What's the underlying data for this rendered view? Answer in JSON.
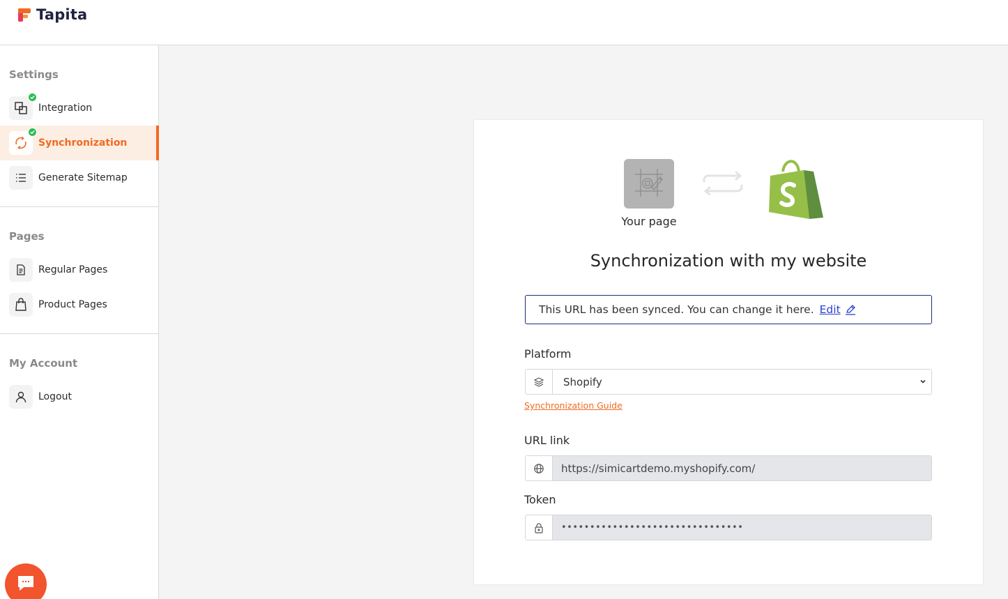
{
  "brand": {
    "name": "Tapita"
  },
  "sidebar": {
    "sections": [
      {
        "title": "Settings"
      },
      {
        "title": "Pages"
      },
      {
        "title": "My Account"
      }
    ],
    "items": [
      {
        "label": "Integration",
        "icon": "integration-icon",
        "checked": true
      },
      {
        "label": "Synchronization",
        "icon": "sync-icon",
        "checked": true,
        "active": true
      },
      {
        "label": "Generate Sitemap",
        "icon": "list-icon"
      },
      {
        "label": "Regular Pages",
        "icon": "document-icon"
      },
      {
        "label": "Product Pages",
        "icon": "shopping-bag-icon"
      },
      {
        "label": "Logout",
        "icon": "user-icon"
      }
    ]
  },
  "card": {
    "your_page_label": "Your page",
    "title": "Synchronization with my website",
    "notice": {
      "text": "This URL has been synced. You can change it here.",
      "edit_label": "Edit"
    },
    "platform": {
      "label": "Platform",
      "selected": "Shopify"
    },
    "guide_link": "Synchronization Guide",
    "url": {
      "label": "URL link",
      "value": "https://simicartdemo.myshopify.com/"
    },
    "token": {
      "label": "Token",
      "value": "••••••••••••••••••••••••••••••••"
    }
  },
  "colors": {
    "accent": "#f26a21",
    "success": "#2fbd57",
    "shopify_green": "#95bf47",
    "shopify_dark": "#5e8e3e",
    "notice_border": "#1f2a7a",
    "link": "#2a3fd1",
    "chat": "#f2542d"
  }
}
